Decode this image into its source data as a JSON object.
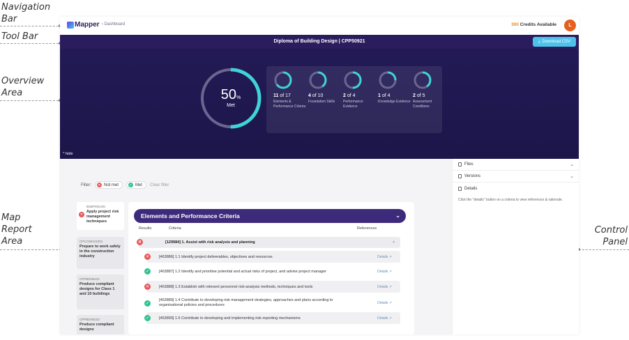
{
  "annotations": {
    "navigation_bar": "Navigation Bar",
    "tool_bar": "Tool Bar",
    "overview_area": "Overview Area",
    "map_report_area": "Map Report Area",
    "control_panel": "Control Panel"
  },
  "navbar": {
    "logo": "Mapper",
    "breadcrumb": "Dashboard",
    "credits_num": "300",
    "credits_label": "Credits Available",
    "avatar_initial": "L"
  },
  "toolbar": {
    "title": "Diploma of Building Design | CPP50921",
    "download_label": "Download CSV"
  },
  "overview": {
    "overall_pct": "50",
    "overall_pct_unit": "%",
    "overall_label": "Met",
    "overall_fraction": 0.5,
    "hide_label": "hide",
    "colors": {
      "ring_fill": "#3fd3d6",
      "ring_track": "#6b6690"
    },
    "stats": [
      {
        "met": "11",
        "of": "of 17",
        "label": "Elements & Performance Criteria",
        "fraction": 0.65
      },
      {
        "met": "4",
        "of": "of 10",
        "label": "Foundation Skills",
        "fraction": 0.4
      },
      {
        "met": "2",
        "of": "of 4",
        "label": "Performance Evidence",
        "fraction": 0.5
      },
      {
        "met": "1",
        "of": "of 4",
        "label": "Knowledge Evidence",
        "fraction": 0.25
      },
      {
        "met": "2",
        "of": "of 5",
        "label": "Assessment Conditions",
        "fraction": 0.4
      }
    ]
  },
  "filter": {
    "label": "Filter:",
    "not_met": "Not met",
    "met": "Met",
    "clear": "Clear filter"
  },
  "units": [
    {
      "code": "BSBPMG426",
      "name": "Apply project risk management techniques",
      "status": "not-met"
    },
    {
      "code": "CPCCWHS1001",
      "name": "Prepare to work safely in the construction industry",
      "status": "none"
    },
    {
      "code": "CPPBDN5102",
      "name": "Produce compliant designs for Class 1 and 10 buildings",
      "status": "none"
    },
    {
      "code": "CPPBDN5103",
      "name": "Produce compliant designs",
      "status": "none"
    }
  ],
  "report": {
    "section_title": "Elements and Performance Criteria",
    "col_results": "Results",
    "col_criteria": "Criteria",
    "col_references": "References",
    "element_heading": "[129984] 1. Assist with risk analysis and planning",
    "details_label": "Details",
    "rows": [
      {
        "text": "[463886] 1.1 Identify project deliverables, objectives and resources",
        "status": "not-met"
      },
      {
        "text": "[463887] 1.2 Identify and prioritise potential and actual risks of project, and advise project manager",
        "status": "met"
      },
      {
        "text": "[463888] 1.3 Establish with relevent personnel risk-analysis methods, techniques and tools",
        "status": "not-met"
      },
      {
        "text": "[463889] 1.4 Contribute to developing risk management strategies, approaches and plans according to organisational policies and procedures",
        "status": "met"
      },
      {
        "text": "[463890] 1.5 Contribute to developing and implementing risk-reporting mechanisms",
        "status": "met"
      }
    ]
  },
  "control_panel": {
    "files": "Files",
    "versions": "Versions",
    "details": "Details",
    "hint": "Click the \"details\" button on a criteria to view references & rationale."
  },
  "colors": {
    "not_met": "#e8575a",
    "met": "#2fc48f",
    "accent": "#4ec3ea",
    "section": "#3d2a7a"
  }
}
